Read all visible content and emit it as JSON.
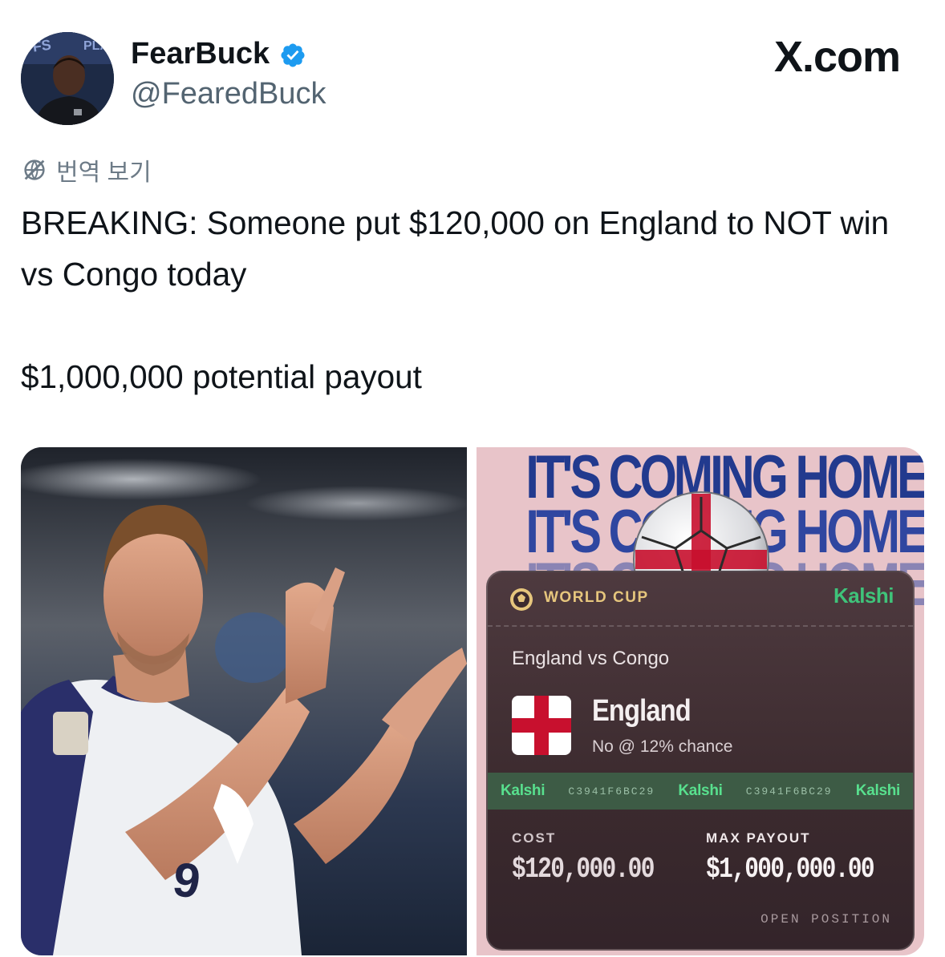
{
  "author": {
    "display_name": "FearBuck",
    "handle": "@FearedBuck",
    "verified_icon": "verified-badge-icon"
  },
  "site_mark": "X.com",
  "translate": {
    "icon": "globe-slash-icon",
    "label": "번역 보기"
  },
  "tweet": {
    "text": "BREAKING: Someone put $120,000 on England to NOT win vs Congo today\n\n$1,000,000 potential payout"
  },
  "media": {
    "promo_lines": [
      "IT'S COMING HOME",
      "IT'S COMING HOME",
      "IT'S COMING HOME"
    ],
    "card": {
      "category": "WORLD CUP",
      "brand": "Kalshi",
      "matchup": "England vs Congo",
      "team": "England",
      "position": "No @ 12% chance",
      "ticker": [
        "Kalshi",
        "C3941F6BC29",
        "Kalshi",
        "C3941F6BC29",
        "Kalshi"
      ],
      "cost_label": "COST",
      "cost_value": "$120,000.00",
      "payout_label": "MAX PAYOUT",
      "payout_value": "$1,000,000.00",
      "footer": "OPEN POSITION"
    }
  },
  "colors": {
    "verified_blue": "#1d9bf0",
    "kalshi_green": "#3fc37a",
    "england_red": "#c8102e",
    "promo_blue": "#223a8e"
  }
}
